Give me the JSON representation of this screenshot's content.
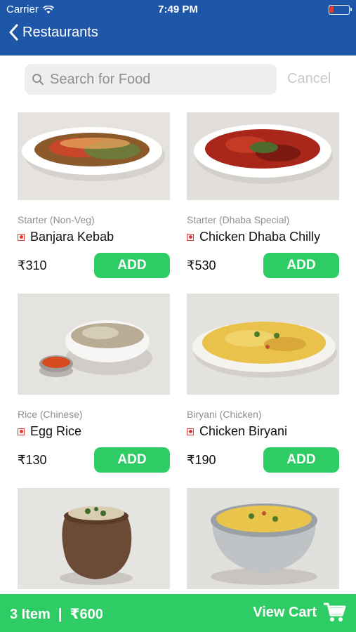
{
  "status_bar": {
    "carrier": "Carrier",
    "time": "7:49 PM"
  },
  "nav": {
    "back_label": "Restaurants"
  },
  "search": {
    "placeholder": "Search for Food",
    "cancel_label": "Cancel"
  },
  "items": [
    {
      "category": "Starter (Non-Veg)",
      "name": "Banjara Kebab",
      "price": "₹310",
      "add_label": "ADD"
    },
    {
      "category": "Starter (Dhaba Special)",
      "name": "Chicken Dhaba Chilly",
      "price": "₹530",
      "add_label": "ADD"
    },
    {
      "category": "Rice (Chinese)",
      "name": "Egg Rice",
      "price": "₹130",
      "add_label": "ADD"
    },
    {
      "category": "Biryani (Chicken)",
      "name": "Chicken Biryani",
      "price": "₹190",
      "add_label": "ADD"
    }
  ],
  "cart": {
    "summary": "3 Item  |  ₹600",
    "view_label": "View Cart"
  },
  "colors": {
    "header": "#1f57a8",
    "accent_green": "#2ecc64",
    "non_veg_marker": "#e53935"
  },
  "icons": [
    "wifi-icon",
    "battery-icon",
    "back-chevron-icon",
    "search-icon",
    "cart-icon",
    "non-veg-marker-icon"
  ]
}
